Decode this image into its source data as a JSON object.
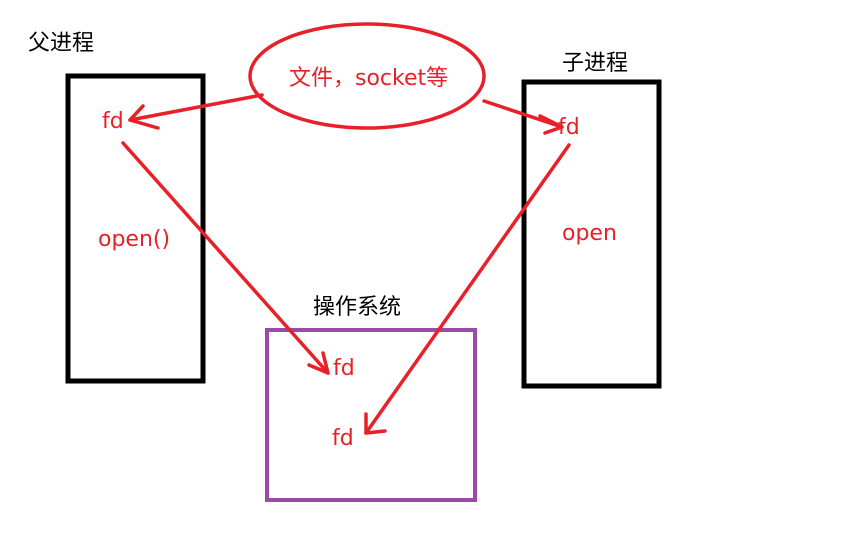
{
  "parent_process": {
    "title": "父进程",
    "fd": "fd",
    "call": "open()"
  },
  "child_process": {
    "title": "子进程",
    "fd": "fd",
    "call": "open"
  },
  "resource": {
    "label": "文件，socket等"
  },
  "os": {
    "title": "操作系统",
    "fd_top": "fd",
    "fd_bottom": "fd"
  },
  "colors": {
    "ink": "#000000",
    "red": "#e8202a",
    "purple": "#9b4aa8"
  }
}
